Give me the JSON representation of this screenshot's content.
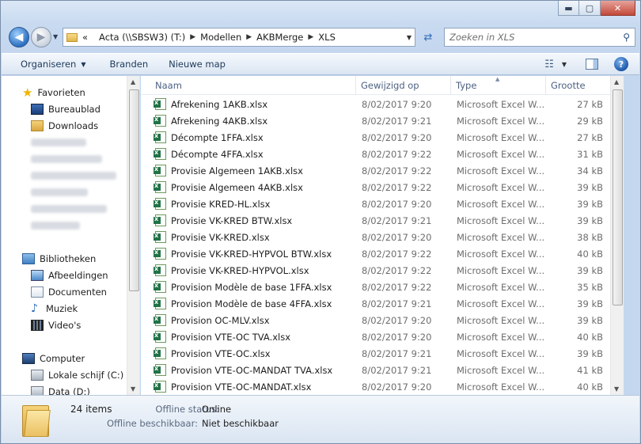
{
  "window": {
    "minimize_glyph": "▬",
    "maximize_glyph": "▢",
    "close_glyph": "✕"
  },
  "navbar": {
    "back_glyph": "◀",
    "forward_glyph": "▶",
    "crumbs": [
      "Acta (\\\\SBSW3) (T:)",
      "Modellen",
      "AKBMerge",
      "XLS"
    ],
    "overflow": "«",
    "search_placeholder": "Zoeken in XLS"
  },
  "toolbar": {
    "organize": "Organiseren",
    "burn": "Branden",
    "new_folder": "Nieuwe map"
  },
  "sidebar": {
    "favorites": "Favorieten",
    "fav_items": [
      "Bureaublad",
      "Downloads"
    ],
    "libraries": "Bibliotheken",
    "lib_items": [
      "Afbeeldingen",
      "Documenten",
      "Muziek",
      "Video's"
    ],
    "computer": "Computer",
    "comp_items": [
      "Lokale schijf (C:)",
      "Data (D:)"
    ]
  },
  "columns": {
    "name": "Naam",
    "modified": "Gewijzigd op",
    "type": "Type",
    "size": "Grootte"
  },
  "files": [
    {
      "name": "Afrekening 1AKB.xlsx",
      "date": "8/02/2017 9:20",
      "type": "Microsoft Excel W...",
      "size": "27 kB"
    },
    {
      "name": "Afrekening 4AKB.xlsx",
      "date": "8/02/2017 9:21",
      "type": "Microsoft Excel W...",
      "size": "29 kB"
    },
    {
      "name": "Décompte 1FFA.xlsx",
      "date": "8/02/2017 9:20",
      "type": "Microsoft Excel W...",
      "size": "27 kB"
    },
    {
      "name": "Décompte 4FFA.xlsx",
      "date": "8/02/2017 9:22",
      "type": "Microsoft Excel W...",
      "size": "31 kB"
    },
    {
      "name": "Provisie Algemeen 1AKB.xlsx",
      "date": "8/02/2017 9:22",
      "type": "Microsoft Excel W...",
      "size": "34 kB"
    },
    {
      "name": "Provisie Algemeen 4AKB.xlsx",
      "date": "8/02/2017 9:22",
      "type": "Microsoft Excel W...",
      "size": "39 kB"
    },
    {
      "name": "Provisie KRED-HL.xlsx",
      "date": "8/02/2017 9:20",
      "type": "Microsoft Excel W...",
      "size": "39 kB"
    },
    {
      "name": "Provisie VK-KRED BTW.xlsx",
      "date": "8/02/2017 9:21",
      "type": "Microsoft Excel W...",
      "size": "39 kB"
    },
    {
      "name": "Provisie VK-KRED.xlsx",
      "date": "8/02/2017 9:20",
      "type": "Microsoft Excel W...",
      "size": "38 kB"
    },
    {
      "name": "Provisie VK-KRED-HYPVOL BTW.xlsx",
      "date": "8/02/2017 9:22",
      "type": "Microsoft Excel W...",
      "size": "40 kB"
    },
    {
      "name": "Provisie VK-KRED-HYPVOL.xlsx",
      "date": "8/02/2017 9:22",
      "type": "Microsoft Excel W...",
      "size": "39 kB"
    },
    {
      "name": "Provision Modèle de base 1FFA.xlsx",
      "date": "8/02/2017 9:22",
      "type": "Microsoft Excel W...",
      "size": "35 kB"
    },
    {
      "name": "Provision Modèle de base 4FFA.xlsx",
      "date": "8/02/2017 9:21",
      "type": "Microsoft Excel W...",
      "size": "39 kB"
    },
    {
      "name": "Provision OC-MLV.xlsx",
      "date": "8/02/2017 9:20",
      "type": "Microsoft Excel W...",
      "size": "39 kB"
    },
    {
      "name": "Provision VTE-OC TVA.xlsx",
      "date": "8/02/2017 9:20",
      "type": "Microsoft Excel W...",
      "size": "40 kB"
    },
    {
      "name": "Provision VTE-OC.xlsx",
      "date": "8/02/2017 9:21",
      "type": "Microsoft Excel W...",
      "size": "39 kB"
    },
    {
      "name": "Provision VTE-OC-MANDAT TVA.xlsx",
      "date": "8/02/2017 9:21",
      "type": "Microsoft Excel W...",
      "size": "41 kB"
    },
    {
      "name": "Provision VTE-OC-MANDAT.xlsx",
      "date": "8/02/2017 9:20",
      "type": "Microsoft Excel W...",
      "size": "40 kB"
    }
  ],
  "details": {
    "count": "24 items",
    "offline_status_label": "Offline status:",
    "offline_status_value": "Online",
    "offline_avail_label": "Offline beschikbaar:",
    "offline_avail_value": "Niet beschikbaar"
  }
}
